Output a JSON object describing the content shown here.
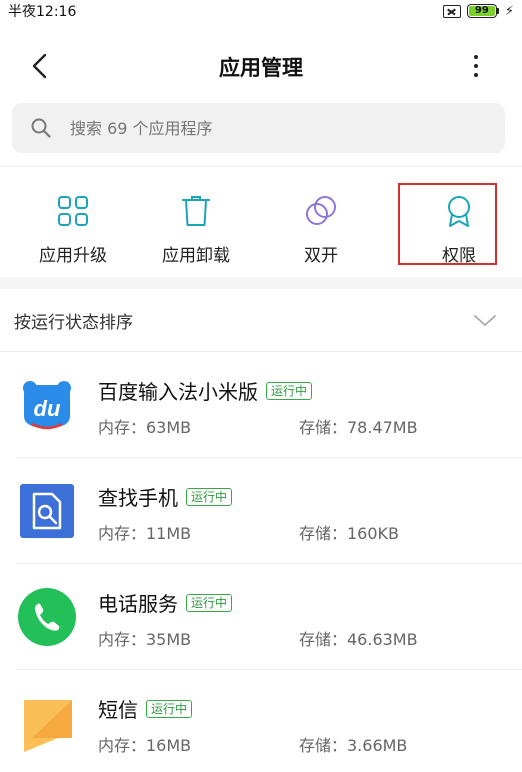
{
  "status_bar": {
    "time": "半夜12:16",
    "battery_level": "99",
    "sim_icon": "sim-error-icon",
    "charging_icon": "bolt-icon"
  },
  "header": {
    "title": "应用管理",
    "back_icon": "chevron-left-icon",
    "more_icon": "more-vertical-icon"
  },
  "search": {
    "placeholder": "搜索 69 个应用程序"
  },
  "quick_actions": [
    {
      "label": "应用升级",
      "icon": "grid-icon"
    },
    {
      "label": "应用卸载",
      "icon": "trash-icon"
    },
    {
      "label": "双开",
      "icon": "dual-circle-icon"
    },
    {
      "label": "权限",
      "icon": "badge-icon"
    }
  ],
  "sort": {
    "label": "按运行状态排序"
  },
  "colors": {
    "accent": "#1aa6b7",
    "running_badge": "#3aa84a",
    "highlight": "#d32f2f"
  },
  "apps": [
    {
      "name": "百度输入法小米版",
      "status": "运行中",
      "memory": "内存：63MB",
      "storage": "存储：78.47MB",
      "icon": "baidu-input-icon"
    },
    {
      "name": "查找手机",
      "status": "运行中",
      "memory": "内存：11MB",
      "storage": "存储：160KB",
      "icon": "find-phone-icon"
    },
    {
      "name": "电话服务",
      "status": "运行中",
      "memory": "内存：35MB",
      "storage": "存储：46.63MB",
      "icon": "phone-icon"
    },
    {
      "name": "短信",
      "status": "运行中",
      "memory": "内存：16MB",
      "storage": "存储：3.66MB",
      "icon": "sms-icon"
    }
  ]
}
